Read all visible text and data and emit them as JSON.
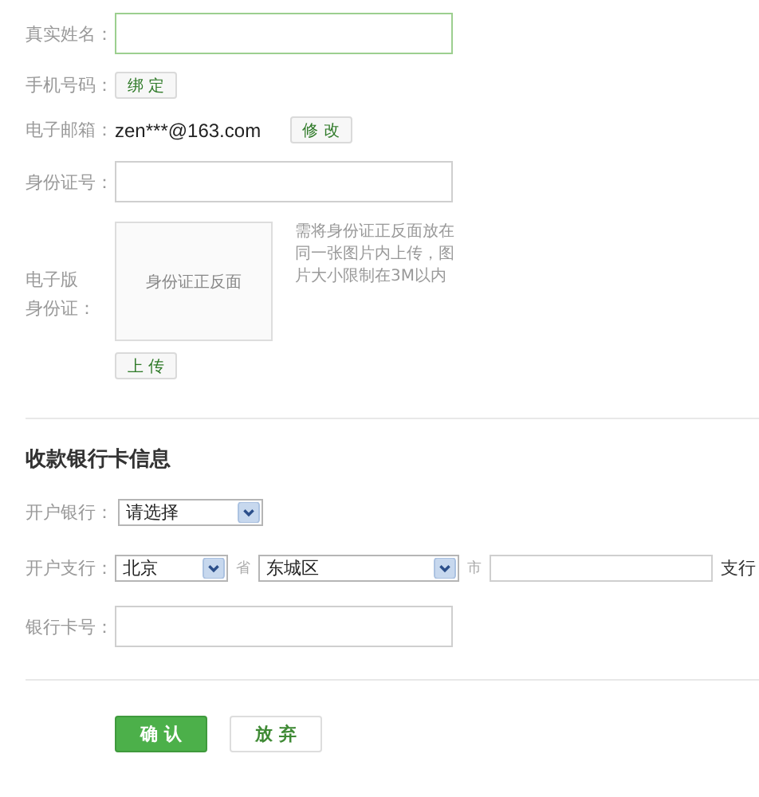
{
  "personal": [
    {
      "kind": "input",
      "label": "真实姓名：",
      "focused": true
    },
    {
      "kind": "button",
      "label": "手机号码：",
      "button": "绑 定"
    },
    {
      "kind": "value",
      "label": "电子邮箱：",
      "value": "zen***@163.com",
      "button": "修 改"
    },
    {
      "kind": "input",
      "label": "身份证号：",
      "focused": false
    }
  ],
  "id_upload": {
    "label_lines": [
      "电子版",
      "身份证："
    ],
    "preview": "身份证正反面",
    "note": "需将身份证正反面放在同一张图片内上传，图片大小限制在3M以内",
    "button": "上 传"
  },
  "bank_section": {
    "title": "收款银行卡信息",
    "bank": {
      "label": "开户银行：",
      "value": "请选择"
    },
    "branch": {
      "label": "开户支行：",
      "province": "北京",
      "province_unit": "省",
      "city": "东城区",
      "city_unit": "市",
      "suffix": "支行"
    },
    "card": {
      "label": "银行卡号："
    }
  },
  "actions": [
    {
      "label": "确 认",
      "primary": true
    },
    {
      "label": "放 弃",
      "primary": false
    }
  ]
}
